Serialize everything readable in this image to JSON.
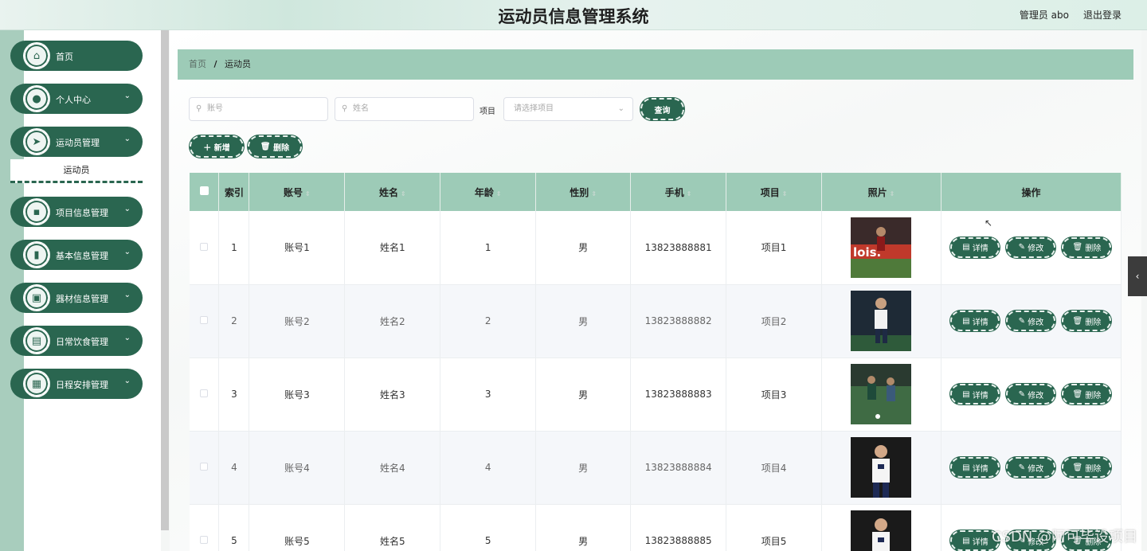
{
  "header": {
    "title": "运动员信息管理系统",
    "user": "管理员 abo",
    "logout": "退出登录"
  },
  "sidebar": {
    "items": [
      {
        "label": "首页",
        "icon": "home-icon",
        "glyph": "⌂",
        "has_children": false
      },
      {
        "label": "个人中心",
        "icon": "user-icon",
        "glyph": "●",
        "has_children": true
      },
      {
        "label": "运动员管理",
        "icon": "send-icon",
        "glyph": "➤",
        "has_children": true
      },
      {
        "label": "项目信息管理",
        "icon": "chat-icon",
        "glyph": "▪",
        "has_children": true
      },
      {
        "label": "基本信息管理",
        "icon": "bar-chart-icon",
        "glyph": "▮",
        "has_children": true
      },
      {
        "label": "器材信息管理",
        "icon": "clipboard-icon",
        "glyph": "▣",
        "has_children": true
      },
      {
        "label": "日常饮食管理",
        "icon": "trend-icon",
        "glyph": "▤",
        "has_children": true
      },
      {
        "label": "日程安排管理",
        "icon": "grid-icon",
        "glyph": "▦",
        "has_children": true
      }
    ],
    "submenu": "运动员"
  },
  "breadcrumb": {
    "home": "首页",
    "current": "运动员"
  },
  "search": {
    "account_placeholder": "账号",
    "name_placeholder": "姓名",
    "project_label": "项目",
    "project_placeholder": "请选择项目",
    "query_button": "查询"
  },
  "actions": {
    "add": "新增",
    "delete": "删除"
  },
  "table": {
    "headers": [
      "索引",
      "账号",
      "姓名",
      "年龄",
      "性别",
      "手机",
      "项目",
      "照片",
      "操作"
    ],
    "rows": [
      {
        "index": "1",
        "account": "账号1",
        "name": "姓名1",
        "age": "1",
        "gender": "男",
        "phone": "13823888881",
        "project": "项目1"
      },
      {
        "index": "2",
        "account": "账号2",
        "name": "姓名2",
        "age": "2",
        "gender": "男",
        "phone": "13823888882",
        "project": "项目2"
      },
      {
        "index": "3",
        "account": "账号3",
        "name": "姓名3",
        "age": "3",
        "gender": "男",
        "phone": "13823888883",
        "project": "项目3"
      },
      {
        "index": "4",
        "account": "账号4",
        "name": "姓名4",
        "age": "4",
        "gender": "男",
        "phone": "13823888884",
        "project": "项目4"
      },
      {
        "index": "5",
        "account": "账号5",
        "name": "姓名5",
        "age": "5",
        "gender": "男",
        "phone": "13823888885",
        "project": "项目5"
      }
    ],
    "row_actions": {
      "detail": "详情",
      "edit": "修改",
      "delete": "删除"
    }
  },
  "watermark": "CSDN @阿可毕设项目",
  "colors": {
    "primary": "#2a6650",
    "header_bg": "#9dcbb7",
    "row_alt": "#f5f7fa"
  }
}
